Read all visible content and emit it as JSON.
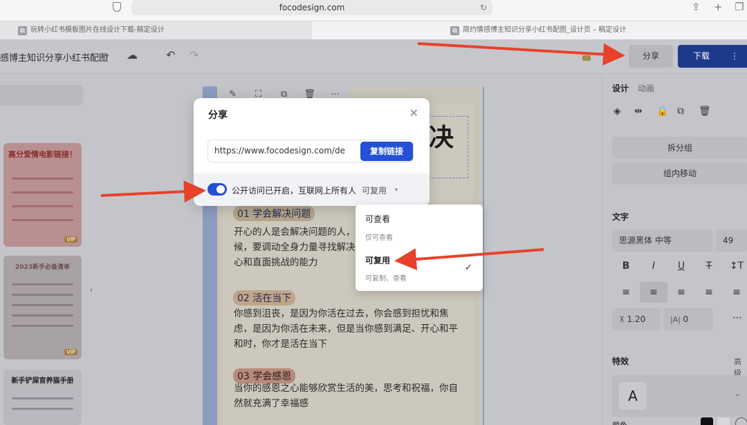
{
  "browser": {
    "url": "focodesign.com",
    "tabs": [
      {
        "icon": "稿",
        "label": "玩转小红书模板图片在线设计下载-稿定设计"
      },
      {
        "icon": "稿",
        "label": "简约情感博主知识分享小红书配图_设计页 – 稿定设计"
      }
    ]
  },
  "header": {
    "doc_title": "感博主知识分享小红书配图",
    "share_label": "分享",
    "download_label": "下载"
  },
  "modal": {
    "title": "分享",
    "link_value": "https://www.focodesign.com/de",
    "copy_label": "复制链接",
    "public_text": "公开访问已开启，互联网上所有人",
    "permission_value": "可复用"
  },
  "dropdown": {
    "options": [
      {
        "label": "可查看",
        "desc": "仅可查看"
      },
      {
        "label": "可复用",
        "desc": "可复制、查看"
      }
    ],
    "selected": "可复用"
  },
  "canvas": {
    "headline_glyph": "决",
    "sections": [
      {
        "heading": "01 学会解决问题",
        "text": "开心的人是会解决问题的人，候，要调动全身力量寻找解决心和直面挑战的能力"
      },
      {
        "heading": "02 活在当下",
        "text": "你感到沮丧，是因为你活在过去，你会感到担忧和焦虑，是因为你活在未来，但是当你感到满足、开心和平和时，你才是活在当下"
      },
      {
        "heading": "03 学会感恩",
        "text": "当你的感恩之心能够欣赏生活的美，思考和祝福，你自然就充满了幸福感"
      }
    ]
  },
  "thumbnails": [
    {
      "title": "高分爱情电影链接！",
      "badge": "VIP"
    },
    {
      "title": "2023新手必备清单",
      "badge": "VIP"
    },
    {
      "title": "新手铲屎官养猫手册",
      "badge": ""
    }
  ],
  "right_panel": {
    "tab_design": "设计",
    "tab_animation": "动画",
    "ungroup_label": "拆分组",
    "move_in_group_label": "组内移动",
    "text_section": "文字",
    "font_name": "思源黑体 中等",
    "font_size": "49",
    "line_height": "1.20",
    "letter_spacing": "0",
    "effects_section": "特效",
    "advanced_label": "高级",
    "color_section": "颜色",
    "effect_preview": "A"
  },
  "colors": {
    "accent_blue": "#2450d5",
    "arrow_red": "#e8412b"
  }
}
